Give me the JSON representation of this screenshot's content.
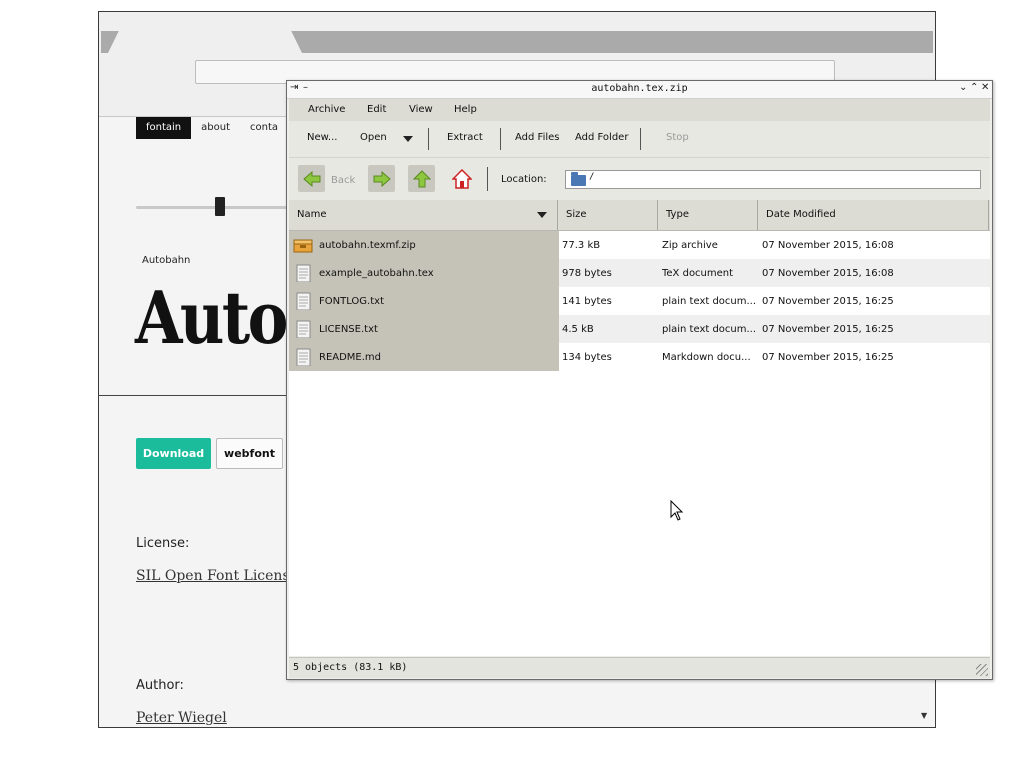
{
  "browser": {
    "nav": [
      "fontain",
      "about",
      "conta"
    ],
    "font_name": "Autobahn",
    "font_preview": "Autob",
    "download_label": "Download",
    "webfont_label": "webfont",
    "license_label": "License:",
    "license_link": "SIL Open Font Licens",
    "author_label": "Author:",
    "author_link": "Peter Wiegel"
  },
  "archiver": {
    "title": "autobahn.tex.zip",
    "menu": [
      "Archive",
      "Edit",
      "View",
      "Help"
    ],
    "toolbar": {
      "new": "New...",
      "open": "Open",
      "extract": "Extract",
      "add_files": "Add Files",
      "add_folder": "Add Folder",
      "stop": "Stop"
    },
    "nav": {
      "back": "Back"
    },
    "location": {
      "label": "Location:",
      "path": "/"
    },
    "columns": [
      "Name",
      "Size",
      "Type",
      "Date Modified"
    ],
    "files": [
      {
        "name": "autobahn.texmf.zip",
        "size": "77.3 kB",
        "type": "Zip archive",
        "date": "07 November 2015, 16:08",
        "icon": "archive-icon"
      },
      {
        "name": "example_autobahn.tex",
        "size": "978 bytes",
        "type": "TeX document",
        "date": "07 November 2015, 16:08",
        "icon": "document-icon"
      },
      {
        "name": "FONTLOG.txt",
        "size": "141 bytes",
        "type": "plain text docum...",
        "date": "07 November 2015, 16:25",
        "icon": "document-icon"
      },
      {
        "name": "LICENSE.txt",
        "size": "4.5 kB",
        "type": "plain text docum...",
        "date": "07 November 2015, 16:25",
        "icon": "document-icon"
      },
      {
        "name": "README.md",
        "size": "134 bytes",
        "type": "Markdown docu...",
        "date": "07 November 2015, 16:25",
        "icon": "document-icon"
      }
    ],
    "status": "5 objects (83.1 kB)"
  }
}
